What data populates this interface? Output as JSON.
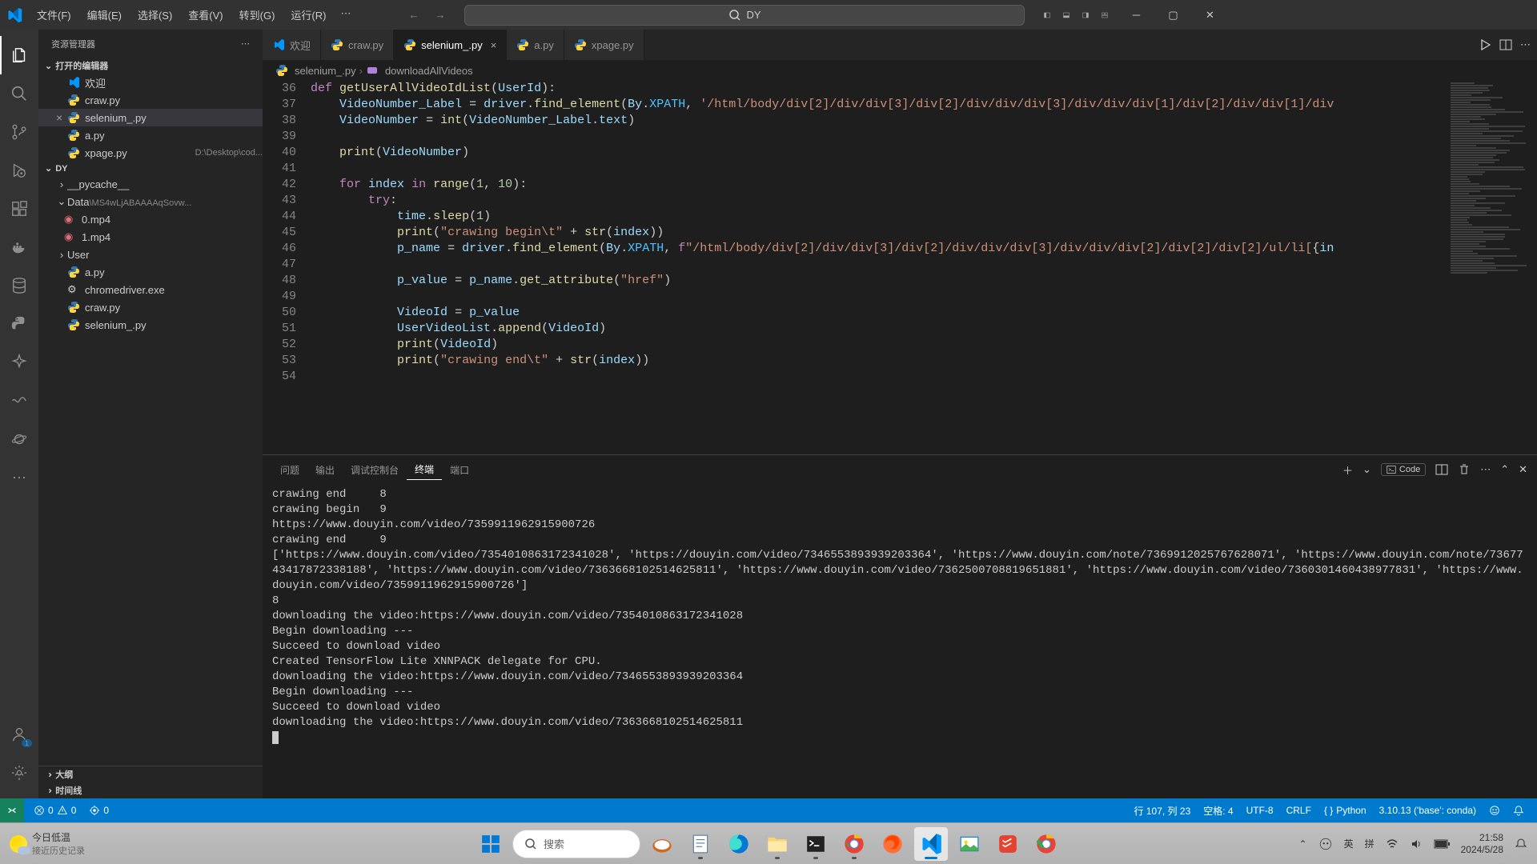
{
  "menubar": {
    "file": "文件(F)",
    "edit": "编辑(E)",
    "select": "选择(S)",
    "view": "查看(V)",
    "goto": "转到(G)",
    "run": "运行(R)"
  },
  "search_placeholder": "DY",
  "sidebar": {
    "title": "资源管理器",
    "open_editors": "打开的编辑器",
    "editors": [
      {
        "label": "欢迎",
        "icon": "vscode"
      },
      {
        "label": "craw.py",
        "icon": "py"
      },
      {
        "label": "selenium_.py",
        "icon": "py",
        "active": true
      },
      {
        "label": "a.py",
        "icon": "py"
      },
      {
        "label": "xpage.py",
        "icon": "py",
        "path": "D:\\Desktop\\cod..."
      }
    ],
    "project": "DY",
    "folders": [
      {
        "label": "__pycache__",
        "type": "folder"
      },
      {
        "label": "Data",
        "type": "folder_open",
        "path": "\\MS4wLjABAAAAqSovw..."
      }
    ],
    "data_files": [
      {
        "label": "0.mp4"
      },
      {
        "label": "1.mp4"
      }
    ],
    "root_items": [
      {
        "label": "User",
        "type": "folder"
      },
      {
        "label": "a.py",
        "type": "py"
      },
      {
        "label": "chromedriver.exe",
        "type": "exe"
      },
      {
        "label": "craw.py",
        "type": "py"
      },
      {
        "label": "selenium_.py",
        "type": "py"
      }
    ],
    "outline": "大纲",
    "timeline": "时间线"
  },
  "tabs": [
    {
      "label": "欢迎",
      "icon": "vscode"
    },
    {
      "label": "craw.py",
      "icon": "py"
    },
    {
      "label": "selenium_.py",
      "icon": "py",
      "active": true,
      "close": true
    },
    {
      "label": "a.py",
      "icon": "py"
    },
    {
      "label": "xpage.py",
      "icon": "py"
    }
  ],
  "breadcrumbs": [
    {
      "icon": "py",
      "label": "selenium_.py"
    },
    {
      "icon": "fn",
      "label": "downloadAllVideos"
    }
  ],
  "line_start": 36,
  "panel": {
    "tabs": [
      "问题",
      "输出",
      "调试控制台",
      "终端",
      "端口"
    ],
    "active": "终端",
    "shell_badge": "Code"
  },
  "terminal_output": "crawing end     8\ncrawing begin   9\nhttps://www.douyin.com/video/7359911962915900726\ncrawing end     9\n['https://www.douyin.com/video/7354010863172341028', 'https://douyin.com/video/7346553893939203364', 'https://www.douyin.com/note/7369912025767628071', 'https://www.douyin.com/note/7367743417872338188', 'https://www.douyin.com/video/7363668102514625811', 'https://www.douyin.com/video/7362500708819651881', 'https://www.douyin.com/video/7360301460438977831', 'https://www.douyin.com/video/7359911962915900726']\n8\ndownloading the video:https://www.douyin.com/video/7354010863172341028\nBegin downloading ---\nSucceed to download video\nCreated TensorFlow Lite XNNPACK delegate for CPU.\ndownloading the video:https://www.douyin.com/video/7346553893939203364\nBegin downloading ---\nSucceed to download video\ndownloading the video:https://www.douyin.com/video/7363668102514625811",
  "statusbar": {
    "errors": "0",
    "warnings": "0",
    "ports": "0",
    "line_col": "行 107, 列 23",
    "spaces": "空格: 4",
    "encoding": "UTF-8",
    "eol": "CRLF",
    "lang": "Python",
    "interpreter": "3.10.13 ('base': conda)"
  },
  "taskbar": {
    "weather_title": "今日低温",
    "weather_sub": "接近历史记录",
    "search": "搜索",
    "ime1": "英",
    "ime2": "拼",
    "time": "21:58",
    "date": "2024/5/28"
  }
}
